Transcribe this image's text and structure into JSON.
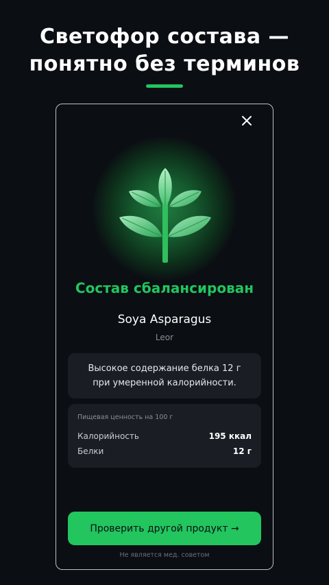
{
  "headline": {
    "line1": "Светофор состава —",
    "line2": "понятно без терминов"
  },
  "colors": {
    "accent": "#22c55e",
    "background": "#0b0e13",
    "panel": "#1a1d23"
  },
  "card": {
    "close_icon": "close-icon",
    "illustration_icon": "plant-sprout-icon",
    "verdict": "Состав сбалансирован",
    "product_name": "Soya Asparagus",
    "brand": "Leor",
    "summary": "Высокое содержание белка 12 г при умеренной калорийности.",
    "nutrition": {
      "title": "Пищевая ценность на 100 г",
      "rows": [
        {
          "label": "Калорийность",
          "value": "195 ккал"
        },
        {
          "label": "Белки",
          "value": "12 г"
        }
      ]
    },
    "cta_label": "Проверить другой продукт →",
    "disclaimer": "Не является мед. советом"
  }
}
